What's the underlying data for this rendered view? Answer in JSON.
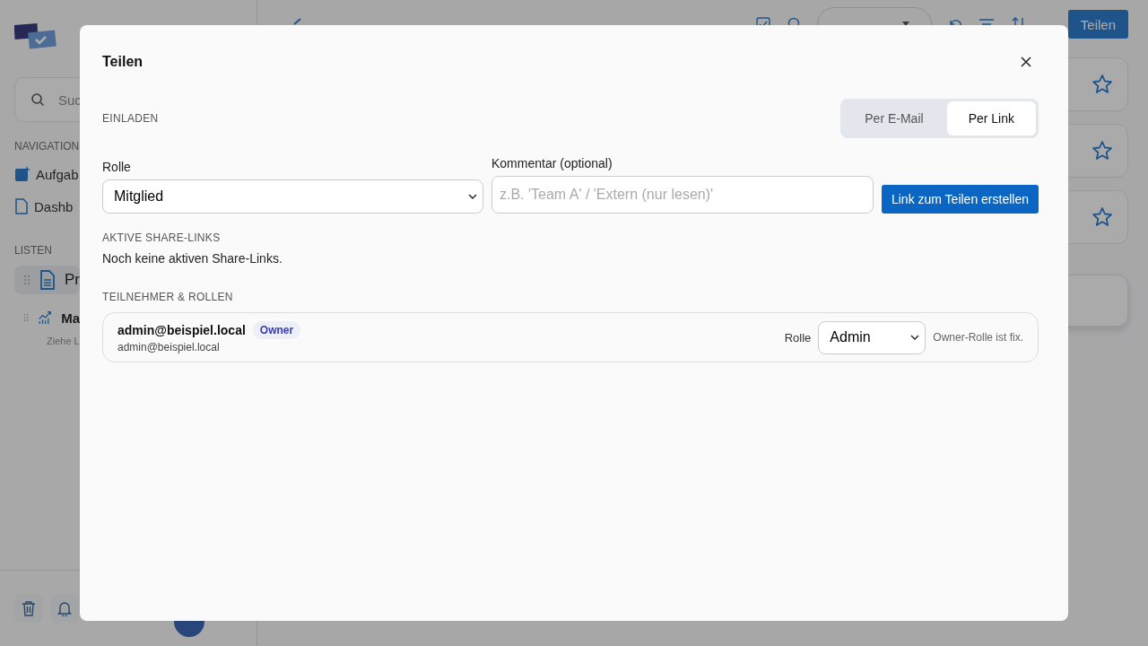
{
  "sidebar": {
    "search": {
      "placeholder": "Suc"
    },
    "navigation_heading": "NAVIGATION",
    "nav_items": [
      {
        "label": "Aufgab",
        "kind": "tasks"
      },
      {
        "label": "Dashb",
        "kind": "page"
      }
    ],
    "lists_heading": "LISTEN",
    "lists": [
      {
        "label": "Pr",
        "kind": "page",
        "selected": true
      },
      {
        "label": "Ma",
        "kind": "chart",
        "selected": false
      }
    ],
    "lists_hint": "Ziehe L"
  },
  "header": {
    "share_button": "Teilen"
  },
  "cards": [
    {
      "kind": "starred"
    },
    {
      "kind": "starred"
    },
    {
      "kind": "starred"
    },
    {
      "kind": "plain"
    }
  ],
  "dialog": {
    "title": "Teilen",
    "section": "EINLADEN",
    "modes": [
      {
        "label": "Per E-Mail",
        "selected": false
      },
      {
        "label": "Per Link",
        "selected": true
      }
    ],
    "role_label": "Rolle",
    "role_value": "Mitglied",
    "comment_label": "Kommentar (optional)",
    "comment_placeholder": "z.B. 'Team A' / 'Extern (nur lesen)'",
    "create_button": "Link zum Teilen erstellen",
    "active_links_heading": "AKTIVE SHARE-LINKS",
    "active_links_empty": "Noch keine aktiven Share-Links.",
    "participants_heading": "TEILNEHMER & ROLLEN",
    "participants": [
      {
        "name": "admin@beispiel.local",
        "email": "admin@beispiel.local",
        "badge": "Owner",
        "role_label": "Rolle",
        "role": "Admin",
        "note": "Owner-Rolle ist fix."
      }
    ]
  }
}
